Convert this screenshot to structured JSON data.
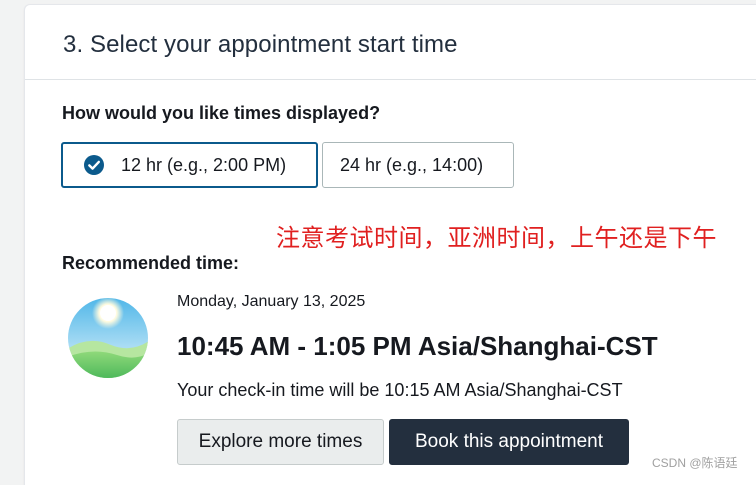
{
  "section": {
    "title": "3. Select your appointment start time"
  },
  "time_format": {
    "question": "How would you like times displayed?",
    "options": [
      {
        "label": "12 hr (e.g., 2:00 PM)",
        "selected": true
      },
      {
        "label": "24 hr (e.g., 14:00)",
        "selected": false
      }
    ]
  },
  "annotation": {
    "note": "注意考试时间，亚洲时间，上午还是下午",
    "color": "#e02020"
  },
  "recommended": {
    "label": "Recommended time:",
    "icon": "daytime-sun-icon",
    "date": "Monday, January 13, 2025",
    "time_range": "10:45 AM - 1:05 PM Asia/Shanghai-CST",
    "checkin": "Your check-in time will be 10:15 AM Asia/Shanghai-CST",
    "explore_label": "Explore more times",
    "book_label": "Book this appointment"
  },
  "watermark": "CSDN @陈语廷",
  "colors": {
    "selected_border": "#0b5a8c",
    "primary_button": "#232f3e",
    "secondary_button": "#eaeded"
  }
}
